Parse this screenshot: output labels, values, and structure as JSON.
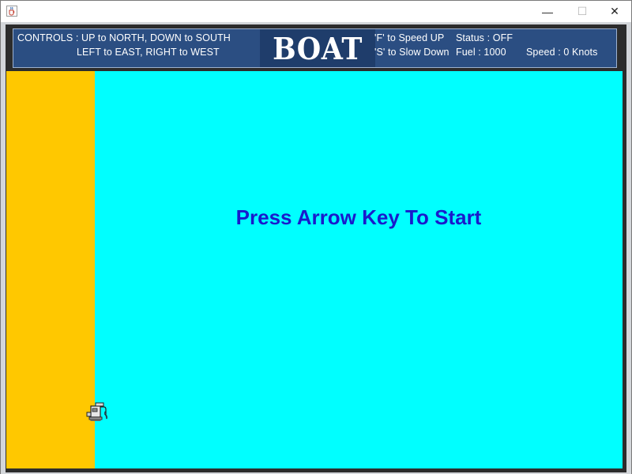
{
  "window": {
    "minimize_glyph": "—",
    "maximize_glyph": "☐",
    "close_glyph": "✕",
    "app_icon": "java-cup-icon"
  },
  "hud": {
    "controls_line1": "CONTROLS : UP to NORTH, DOWN to SOUTH",
    "controls_line2": "LEFT to EAST, RIGHT to WEST",
    "title": "BOAT",
    "speed_up_hint": "'F' to Speed UP",
    "slow_down_hint": "'S' to Slow Down",
    "status": "Status : OFF",
    "fuel": "Fuel : 1000",
    "speed": "Speed : 0 Knots"
  },
  "playfield": {
    "start_message": "Press Arrow Key To Start",
    "water_color": "#00ffff",
    "shore_color": "#ffc800",
    "message_color": "#1a1acc",
    "fuel_station_icon": "fuel-pump-icon"
  },
  "colors": {
    "hud_background": "#2b4e82",
    "hud_text": "#ffffff"
  }
}
